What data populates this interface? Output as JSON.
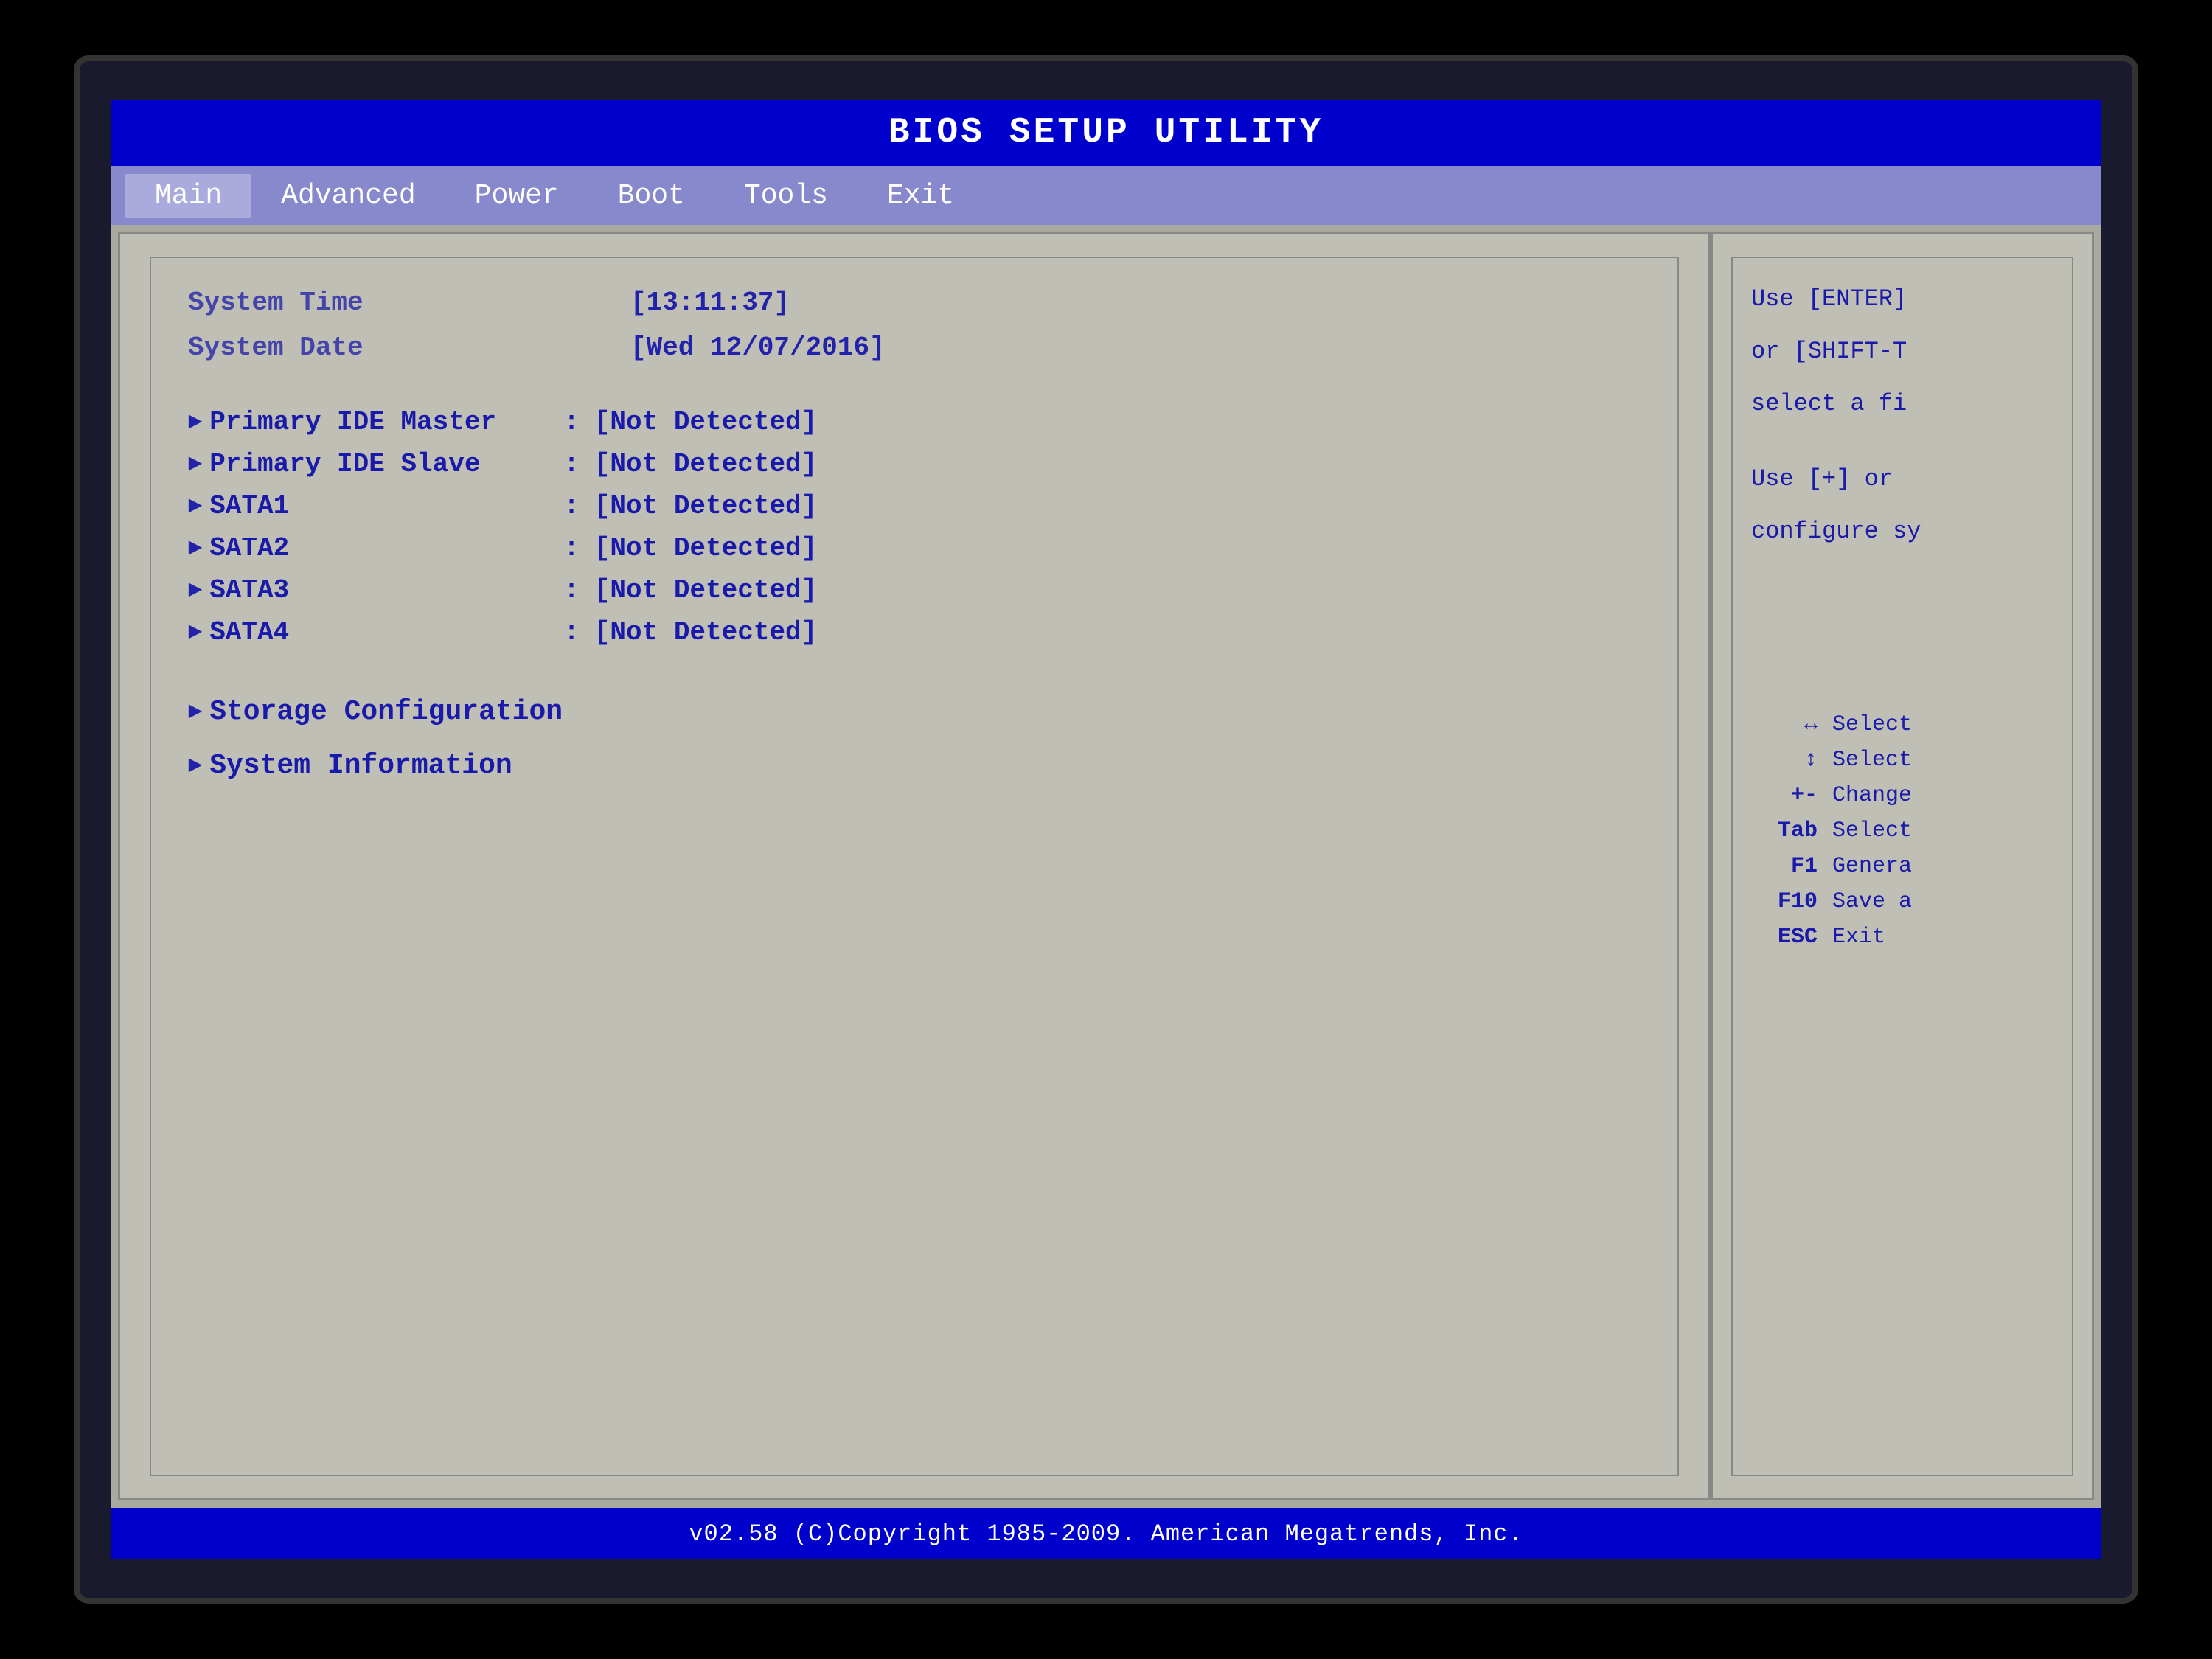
{
  "title_bar": {
    "text": "BIOS  SETUP  UTILITY"
  },
  "menu": {
    "items": [
      {
        "label": "Main",
        "active": true
      },
      {
        "label": "Advanced",
        "active": false
      },
      {
        "label": "Power",
        "active": false
      },
      {
        "label": "Boot",
        "active": false
      },
      {
        "label": "Tools",
        "active": false
      },
      {
        "label": "Exit",
        "active": false
      }
    ]
  },
  "main_panel": {
    "system_time_label": "System Time",
    "system_time_value": "[13:11:37]",
    "system_date_label": "System Date",
    "system_date_value": "[Wed 12/07/2016]",
    "devices": [
      {
        "label": "Primary IDE Master",
        "status": "[Not Detected]"
      },
      {
        "label": "Primary IDE Slave",
        "status": "[Not Detected]"
      },
      {
        "label": "SATA1",
        "status": "[Not Detected]"
      },
      {
        "label": "SATA2",
        "status": "[Not Detected]"
      },
      {
        "label": "SATA3",
        "status": "[Not Detected]"
      },
      {
        "label": "SATA4",
        "status": "[Not Detected]"
      }
    ],
    "submenus": [
      {
        "label": "Storage Configuration"
      },
      {
        "label": "System Information"
      }
    ]
  },
  "right_panel": {
    "help_lines": [
      "Use [ENTER]",
      "or [SHIFT-T",
      "select a fi",
      "",
      "Use [+] or",
      "configure sy"
    ],
    "shortcuts": [
      {
        "key": "↔",
        "desc": "Select"
      },
      {
        "key": "↕",
        "desc": "Select"
      },
      {
        "key": "+-",
        "desc": "Change"
      },
      {
        "key": "Tab",
        "desc": "Select"
      },
      {
        "key": "F1",
        "desc": "Genera"
      },
      {
        "key": "F10",
        "desc": "Save a"
      },
      {
        "key": "ESC",
        "desc": "Exit"
      }
    ]
  },
  "status_bar": {
    "text": "v02.58  (C)Copyright 1985-2009. American Megatrends, Inc."
  }
}
